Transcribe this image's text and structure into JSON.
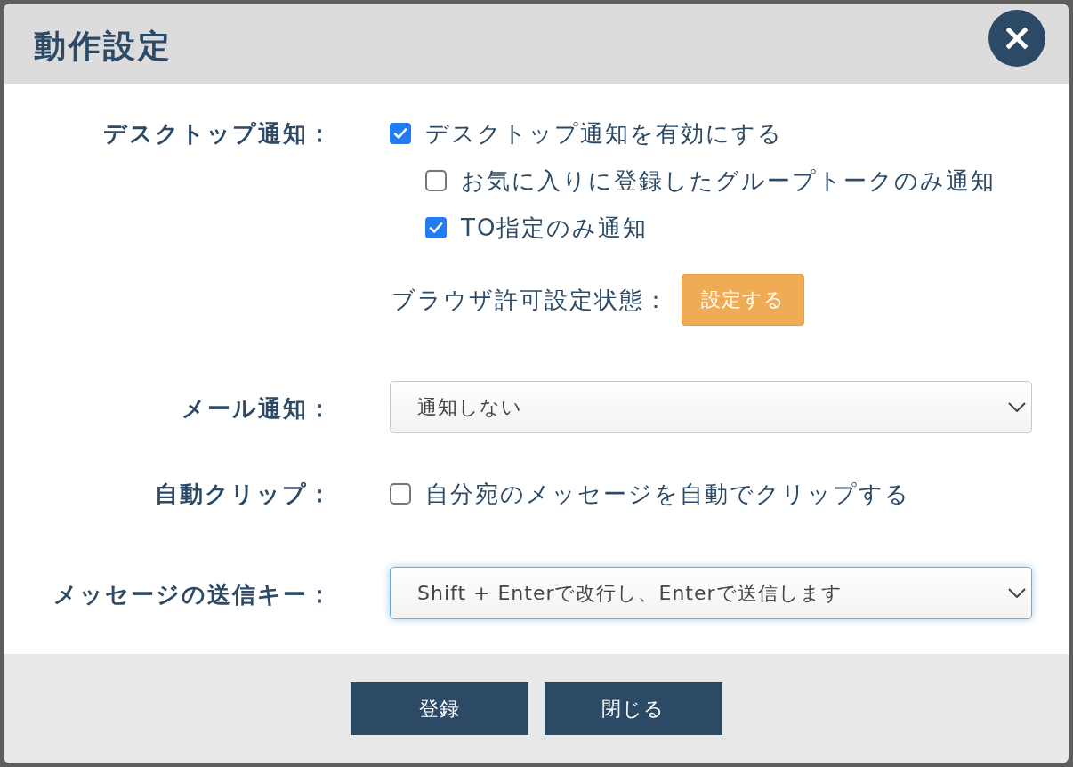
{
  "dialog": {
    "title": "動作設定"
  },
  "settings": [
    {
      "kind": "checkboxes",
      "label": "デスクトップ通知：",
      "options": [
        {
          "label": "デスクトップ通知を有効にする",
          "checked": true,
          "children": [
            {
              "label": "お気に入りに登録したグループトークのみ通知",
              "checked": false
            },
            {
              "label": "TO指定のみ通知",
              "checked": true
            }
          ]
        }
      ],
      "permission": {
        "label": "ブラウザ許可設定状態：",
        "button": "設定する"
      }
    },
    {
      "kind": "select",
      "label": "メール通知：",
      "value": "通知しない",
      "focused": false
    },
    {
      "kind": "checkboxes",
      "label": "自動クリップ：",
      "options": [
        {
          "label": "自分宛のメッセージを自動でクリップする",
          "checked": false
        }
      ]
    },
    {
      "kind": "select",
      "label": "メッセージの送信キー：",
      "value": "Shift + Enterで改行し、Enterで送信します",
      "focused": true
    }
  ],
  "buttons": [
    "登録",
    "閉じる"
  ]
}
